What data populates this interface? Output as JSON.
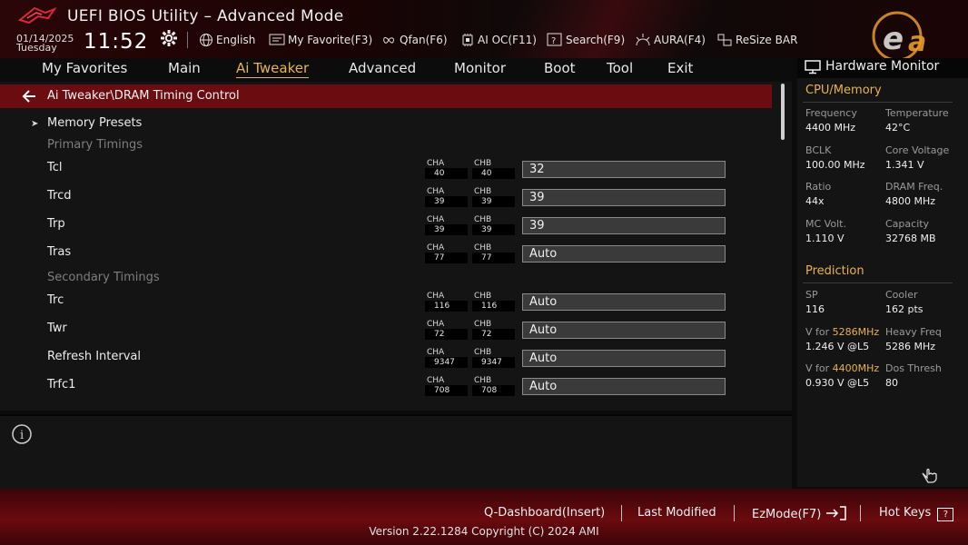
{
  "header": {
    "title": "UEFI BIOS Utility – Advanced Mode",
    "date": "01/14/2025",
    "day": "Tuesday",
    "time": "11:52",
    "toolbar": [
      {
        "label": "English",
        "icon": "globe-icon"
      },
      {
        "label": "My Favorite(F3)",
        "icon": "favorite-icon"
      },
      {
        "label": "Qfan(F6)",
        "icon": "fan-icon"
      },
      {
        "label": "AI OC(F11)",
        "icon": "ai-oc-icon"
      },
      {
        "label": "Search(F9)",
        "icon": "search-icon"
      },
      {
        "label": "AURA(F4)",
        "icon": "aura-icon"
      },
      {
        "label": "ReSize BAR",
        "icon": "resize-bar-icon"
      }
    ]
  },
  "nav": {
    "tabs": [
      "My Favorites",
      "Main",
      "Ai Tweaker",
      "Advanced",
      "Monitor",
      "Boot",
      "Tool",
      "Exit"
    ],
    "active": "Ai Tweaker"
  },
  "main": {
    "breadcrumb": "Ai Tweaker\\DRAM Timing Control",
    "memory_presets": "Memory Presets",
    "sections": {
      "primary": "Primary Timings",
      "secondary": "Secondary Timings"
    },
    "channel_labels": {
      "a": "CHA",
      "b": "CHB"
    },
    "rows": [
      {
        "label": "Tcl",
        "cha": "40",
        "chb": "40",
        "value": "32"
      },
      {
        "label": "Trcd",
        "cha": "39",
        "chb": "39",
        "value": "39"
      },
      {
        "label": "Trp",
        "cha": "39",
        "chb": "39",
        "value": "39"
      },
      {
        "label": "Tras",
        "cha": "77",
        "chb": "77",
        "value": "Auto"
      },
      {
        "label": "Trc",
        "cha": "116",
        "chb": "116",
        "value": "Auto"
      },
      {
        "label": "Twr",
        "cha": "72",
        "chb": "72",
        "value": "Auto"
      },
      {
        "label": "Refresh Interval",
        "cha": "9347",
        "chb": "9347",
        "value": "Auto"
      },
      {
        "label": "Trfc1",
        "cha": "708",
        "chb": "708",
        "value": "Auto"
      }
    ]
  },
  "hw": {
    "title": "Hardware Monitor",
    "cpu_section": "CPU/Memory",
    "cpu": [
      {
        "k": "Frequency",
        "v": "4400 MHz"
      },
      {
        "k": "Temperature",
        "v": "42°C"
      },
      {
        "k": "BCLK",
        "v": "100.00 MHz"
      },
      {
        "k": "Core Voltage",
        "v": "1.341 V"
      },
      {
        "k": "Ratio",
        "v": "44x"
      },
      {
        "k": "DRAM Freq.",
        "v": "4800 MHz"
      },
      {
        "k": "MC Volt.",
        "v": "1.110 V"
      },
      {
        "k": "Capacity",
        "v": "32768 MB"
      }
    ],
    "pred_section": "Prediction",
    "pred": {
      "sp_k": "SP",
      "sp_v": "116",
      "cooler_k": "Cooler",
      "cooler_v": "162 pts",
      "v_for": "V for",
      "freq1": "5286MHz",
      "v1": "1.246 V @L5",
      "heavy_k": "Heavy Freq",
      "heavy_v": "5286 MHz",
      "freq2": "4400MHz",
      "v2": "0.930 V @L5",
      "dos_k": "Dos Thresh",
      "dos_v": "80"
    }
  },
  "footer": {
    "q_dashboard": "Q-Dashboard(Insert)",
    "last_modified": "Last Modified",
    "ezmode": "EzMode(F7)",
    "hotkeys": "Hot Keys",
    "hotkeys_key": "?",
    "version": "Version 2.22.1284 Copyright (C) 2024 AMI"
  },
  "colors": {
    "accent": "#e8b34f",
    "breadcrumb_bg": "#6b0d10",
    "footer_red": "#6a0a0f"
  }
}
